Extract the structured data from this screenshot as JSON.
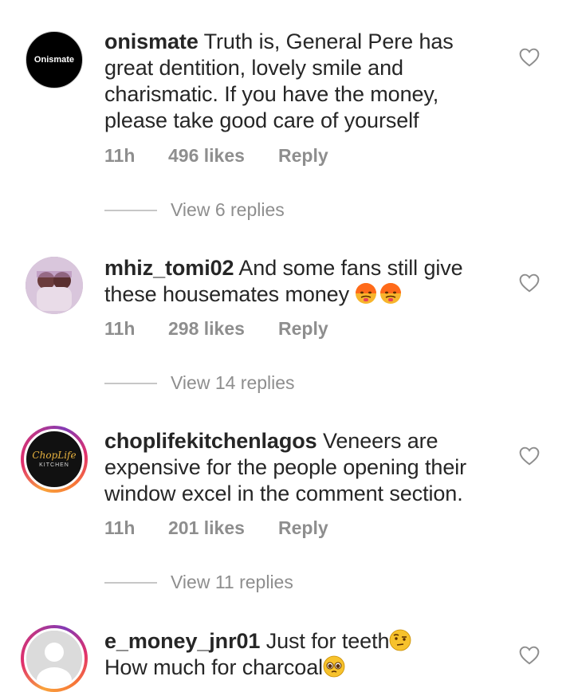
{
  "comments": [
    {
      "username": "onismate",
      "text": " Truth is, General Pere has great dentition, lovely smile and charismatic. If you have the money, please take good care of yourself",
      "avatar_label": "Onismate",
      "time": "11h",
      "likes": "496 likes",
      "reply": "Reply",
      "view_replies": "View 6 replies"
    },
    {
      "username": "mhiz_tomi02",
      "text": " And some fans still give these housemates money ",
      "emojis": [
        "hot-face-emoji",
        "hot-face-emoji"
      ],
      "time": "11h",
      "likes": "298 likes",
      "reply": "Reply",
      "view_replies": "View 14 replies"
    },
    {
      "username": "choplifekitchenlagos",
      "text": " Veneers are expensive for the people opening their window excel in the comment section.",
      "avatar_label": "ChopLife",
      "avatar_sublabel": "KITCHEN",
      "time": "11h",
      "likes": "201 likes",
      "reply": "Reply",
      "view_replies": "View 11 replies"
    },
    {
      "username": "e_money_jnr01",
      "text_line1": " Just for teeth",
      "text_line2": "How much for charcoal",
      "emojis": [
        "face-with-raised-eyebrow-emoji",
        "pleading-face-emoji"
      ]
    }
  ],
  "colors": {
    "text": "#262626",
    "muted": "#8e8e8e",
    "divider": "#c7c7c7"
  }
}
